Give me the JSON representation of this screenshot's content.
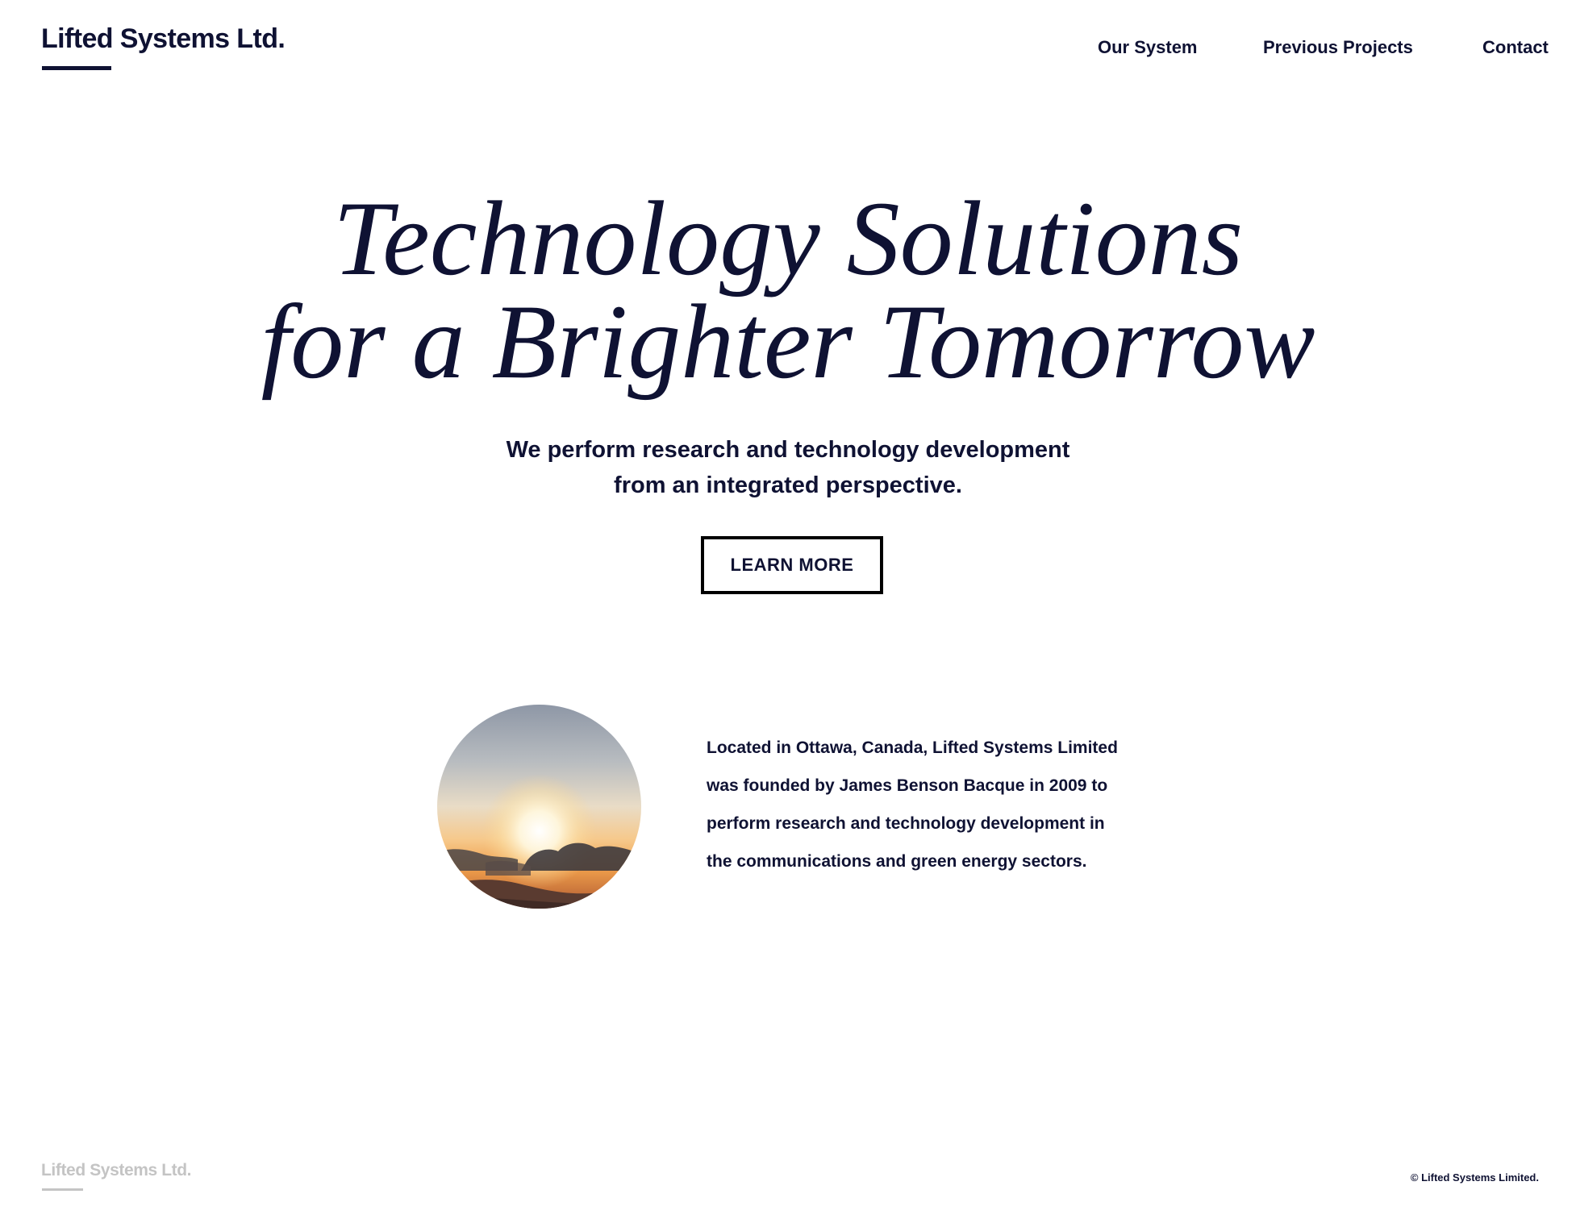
{
  "header": {
    "logo_text": "Lifted Systems Ltd.",
    "nav": [
      {
        "label": "Our System"
      },
      {
        "label": "Previous Projects"
      },
      {
        "label": "Contact"
      }
    ]
  },
  "hero": {
    "title_line_1": "Technology Solutions",
    "title_line_2": "for a Brighter Tomorrow",
    "subtitle_line_1": "We perform research and technology development",
    "subtitle_line_2": "from an integrated perspective.",
    "cta_label": "LEARN MORE"
  },
  "about": {
    "image_subject": "sunset-over-clouds",
    "lines": [
      "Located in Ottawa, Canada, Lifted Systems Limited",
      "was founded by James Benson Bacque in 2009 to",
      "perform research and technology development in",
      "the communications and green energy sectors."
    ]
  },
  "footer": {
    "logo_text": "Lifted Systems Ltd.",
    "copyright": "© Lifted Systems Limited."
  },
  "colors": {
    "ink": "#0f1233",
    "footer_logo": "#c4c4c4",
    "background": "#ffffff",
    "button_border": "#000000"
  }
}
